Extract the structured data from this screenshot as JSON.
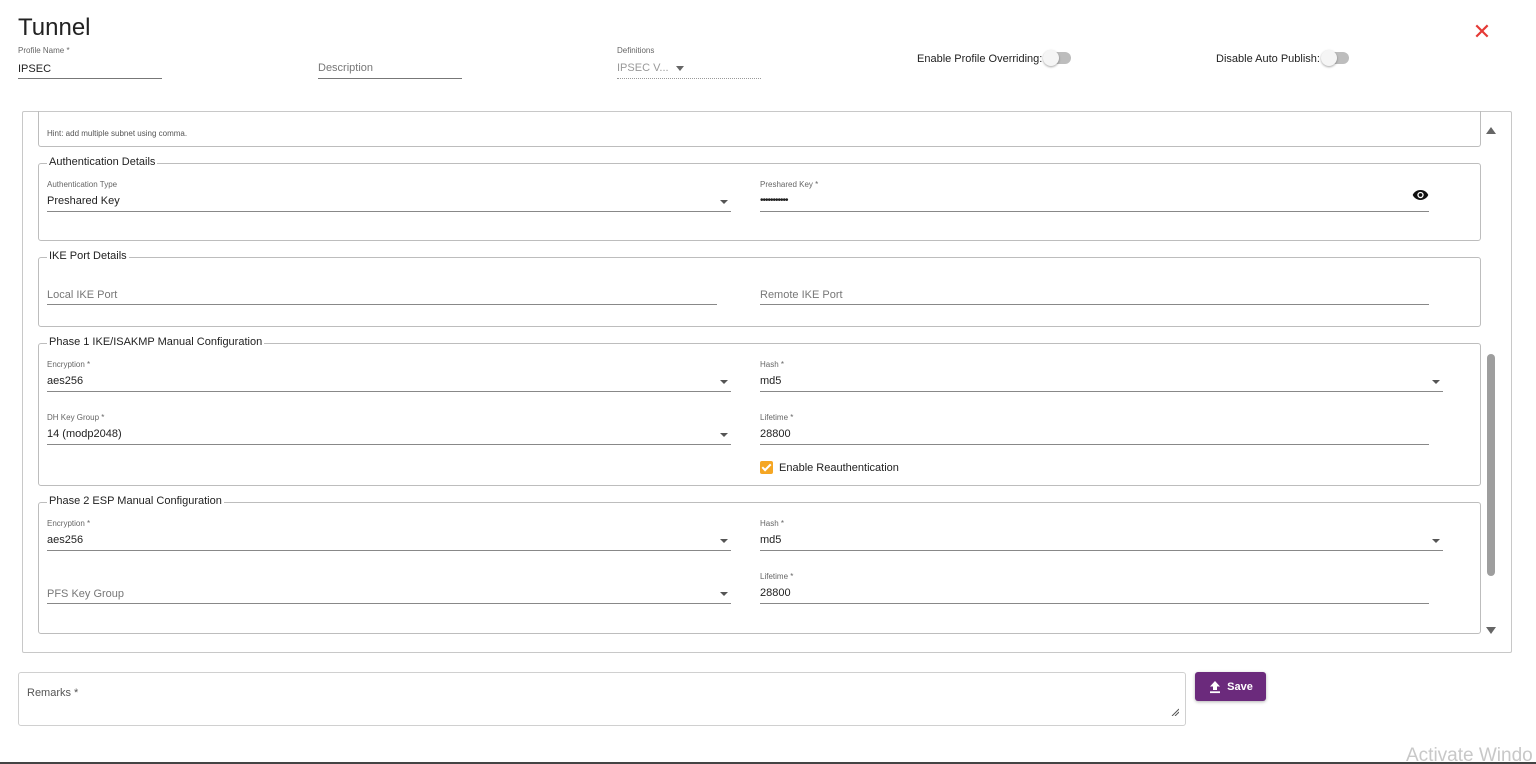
{
  "header": {
    "title": "Tunnel",
    "profile_name_label": "Profile Name *",
    "profile_name_value": "IPSEC",
    "description_placeholder": "Description",
    "definitions_label": "Definitions",
    "definitions_value": "IPSEC V...",
    "enable_profile_overriding_label": "Enable Profile Overriding:",
    "enable_profile_overriding_on": false,
    "disable_auto_publish_label": "Disable Auto Publish:",
    "disable_auto_publish_on": false,
    "close_icon": "close-icon",
    "close_color": "#e53935"
  },
  "subnet_section": {
    "hint": "Hint: add multiple subnet using comma."
  },
  "authentication": {
    "legend": "Authentication Details",
    "type_label": "Authentication Type",
    "type_value": "Preshared Key",
    "key_label": "Preshared Key *",
    "key_value": "•••••••••••",
    "visibility_icon": "eye-icon"
  },
  "ike_port": {
    "legend": "IKE Port Details",
    "local_placeholder": "Local IKE Port",
    "remote_placeholder": "Remote IKE Port"
  },
  "phase1": {
    "legend": "Phase 1 IKE/ISAKMP Manual Configuration",
    "encryption_label": "Encryption *",
    "encryption_value": "aes256",
    "hash_label": "Hash *",
    "hash_value": "md5",
    "dh_label": "DH Key Group *",
    "dh_value": "14 (modp2048)",
    "lifetime_label": "Lifetime *",
    "lifetime_value": "28800",
    "reauth_label": "Enable Reauthentication",
    "reauth_checked": true,
    "checkbox_color": "#f5a623"
  },
  "phase2": {
    "legend": "Phase 2 ESP Manual Configuration",
    "encryption_label": "Encryption *",
    "encryption_value": "aes256",
    "hash_label": "Hash *",
    "hash_value": "md5",
    "pfs_placeholder": "PFS Key Group",
    "lifetime_label": "Lifetime *",
    "lifetime_value": "28800"
  },
  "footer": {
    "remarks_placeholder": "Remarks *",
    "save_label": "Save",
    "save_icon": "upload-icon",
    "save_color": "#6b2a7c"
  },
  "watermark": "Activate Windo"
}
